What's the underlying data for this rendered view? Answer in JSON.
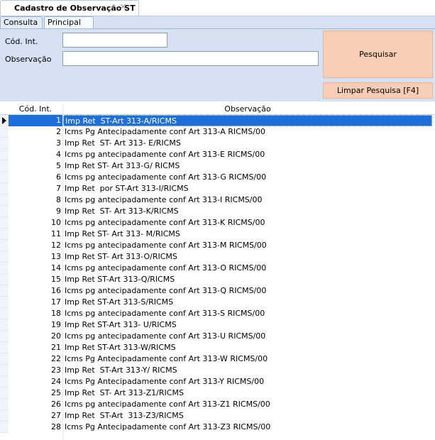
{
  "window": {
    "tab_title": "Cadastro de Observação ST",
    "close_glyph": "✕"
  },
  "subtabs": [
    {
      "label": "Consulta"
    },
    {
      "label": "Principal"
    }
  ],
  "form": {
    "cod_int_label": "Cód. Int.",
    "cod_int_value": "",
    "observacao_label": "Observação",
    "observacao_value": ""
  },
  "buttons": {
    "pesquisar": "Pesquisar",
    "limpar": "Limpar Pesquisa [F4]"
  },
  "grid": {
    "headers": {
      "codigo": "Cód. Int.",
      "observacao": "Observação"
    },
    "selected_index": 0,
    "rows": [
      {
        "codigo": "1",
        "observacao": "Imp Ret  ST-Art 313-A/RICMS"
      },
      {
        "codigo": "2",
        "observacao": "Icms Pg Antecipadamente conf Art 313-A RICMS/00"
      },
      {
        "codigo": "3",
        "observacao": "Imp Ret  ST- Art 313- E/RICMS"
      },
      {
        "codigo": "4",
        "observacao": "Icms pg antecipadamente conf Art 313-E RICMS/00"
      },
      {
        "codigo": "5",
        "observacao": "Imp Ret ST- Art 313-G/ RICMS"
      },
      {
        "codigo": "6",
        "observacao": "Icms pg antecipadamente conf Art 313-G RICMS/00"
      },
      {
        "codigo": "7",
        "observacao": "Imp Ret  por ST-Art 313-I/RICMS"
      },
      {
        "codigo": "8",
        "observacao": "Icms pg antecipadamente conf Art 313-I RICMS/00"
      },
      {
        "codigo": "9",
        "observacao": "Imp Ret  ST- Art 313-K/RICMS"
      },
      {
        "codigo": "10",
        "observacao": "Icms pg antecipadamente conf Art 313-K RICMS/00"
      },
      {
        "codigo": "11",
        "observacao": "Imp Ret ST- Art 313- M/RICMS"
      },
      {
        "codigo": "12",
        "observacao": "Icms pg antecipadamente conf Art 313-M RICMS/00"
      },
      {
        "codigo": "13",
        "observacao": "Imp Ret ST- Art 313-O/RICMS"
      },
      {
        "codigo": "14",
        "observacao": "Icms pg antecipadamente conf Art 313-O RICMS/00"
      },
      {
        "codigo": "15",
        "observacao": "Imp Ret ST-Art 313-Q/RICMS"
      },
      {
        "codigo": "16",
        "observacao": "Icms pg antecipadamente conf Art 313-Q RICMS/00"
      },
      {
        "codigo": "17",
        "observacao": "Imp Ret ST-Art 313-S/RICMS"
      },
      {
        "codigo": "18",
        "observacao": "Icms pg antecipadamente conf Art 313-S RICMS/00"
      },
      {
        "codigo": "19",
        "observacao": "Imp Ret ST-Art 313- U/RICMS"
      },
      {
        "codigo": "20",
        "observacao": "Icms pg antecipadamente conf Art 313-U RICMS/00"
      },
      {
        "codigo": "21",
        "observacao": "Imp Ret ST-Art 313-W/RICMS"
      },
      {
        "codigo": "22",
        "observacao": "Icms Pg Antecipadamente conf Art 313-W RICMS/00"
      },
      {
        "codigo": "23",
        "observacao": "Imp Ret  ST-Art 313-Y/ RICMS"
      },
      {
        "codigo": "24",
        "observacao": "Icms Pg Antecipadamente conf Art 313-Y RICMS/00"
      },
      {
        "codigo": "25",
        "observacao": "Imp Ret  ST- Art 313-Z1/RICMS"
      },
      {
        "codigo": "26",
        "observacao": "Icms pg antecipadamente conf Art 313-Z1 RICMS/00"
      },
      {
        "codigo": "27",
        "observacao": "Imp Ret  ST-Art  313-Z3/RICMS"
      },
      {
        "codigo": "28",
        "observacao": "Icms Pg Antecipadamente conf Art 313-Z3 RICMS/00"
      }
    ]
  },
  "colors": {
    "selection": "#1e6fd9",
    "panel": "#d6e2f2",
    "button": "#f9ccb4"
  }
}
